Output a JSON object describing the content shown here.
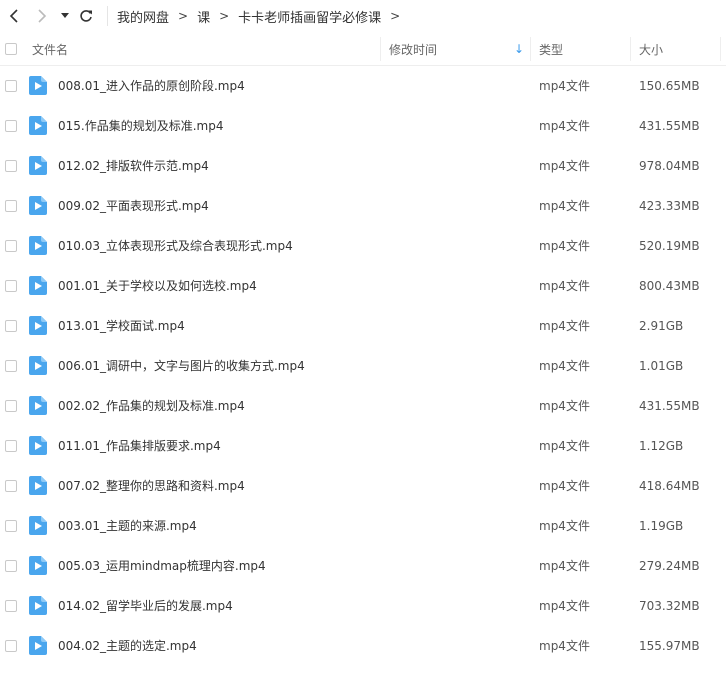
{
  "breadcrumb": [
    "我的网盘",
    "课",
    "卡卡老师插画留学必修课"
  ],
  "header": {
    "name": "文件名",
    "modified": "修改时间",
    "type": "类型",
    "size": "大小",
    "sort_indicator": "↓"
  },
  "colors": {
    "accent": "#3b9bec",
    "icon_blue": "#4aa6ee"
  },
  "files": [
    {
      "name": "008.01_进入作品的原创阶段.mp4",
      "type": "mp4文件",
      "size": "150.65MB"
    },
    {
      "name": "015.作品集的规划及标准.mp4",
      "type": "mp4文件",
      "size": "431.55MB"
    },
    {
      "name": "012.02_排版软件示范.mp4",
      "type": "mp4文件",
      "size": "978.04MB"
    },
    {
      "name": "009.02_平面表现形式.mp4",
      "type": "mp4文件",
      "size": "423.33MB"
    },
    {
      "name": "010.03_立体表现形式及综合表现形式.mp4",
      "type": "mp4文件",
      "size": "520.19MB"
    },
    {
      "name": "001.01_关于学校以及如何选校.mp4",
      "type": "mp4文件",
      "size": "800.43MB"
    },
    {
      "name": "013.01_学校面试.mp4",
      "type": "mp4文件",
      "size": "2.91GB"
    },
    {
      "name": "006.01_调研中，文字与图片的收集方式.mp4",
      "type": "mp4文件",
      "size": "1.01GB"
    },
    {
      "name": "002.02_作品集的规划及标准.mp4",
      "type": "mp4文件",
      "size": "431.55MB"
    },
    {
      "name": "011.01_作品集排版要求.mp4",
      "type": "mp4文件",
      "size": "1.12GB"
    },
    {
      "name": "007.02_整理你的思路和资料.mp4",
      "type": "mp4文件",
      "size": "418.64MB"
    },
    {
      "name": "003.01_主题的来源.mp4",
      "type": "mp4文件",
      "size": "1.19GB"
    },
    {
      "name": "005.03_运用mindmap梳理内容.mp4",
      "type": "mp4文件",
      "size": "279.24MB"
    },
    {
      "name": "014.02_留学毕业后的发展.mp4",
      "type": "mp4文件",
      "size": "703.32MB"
    },
    {
      "name": "004.02_主题的选定.mp4",
      "type": "mp4文件",
      "size": "155.97MB"
    }
  ]
}
